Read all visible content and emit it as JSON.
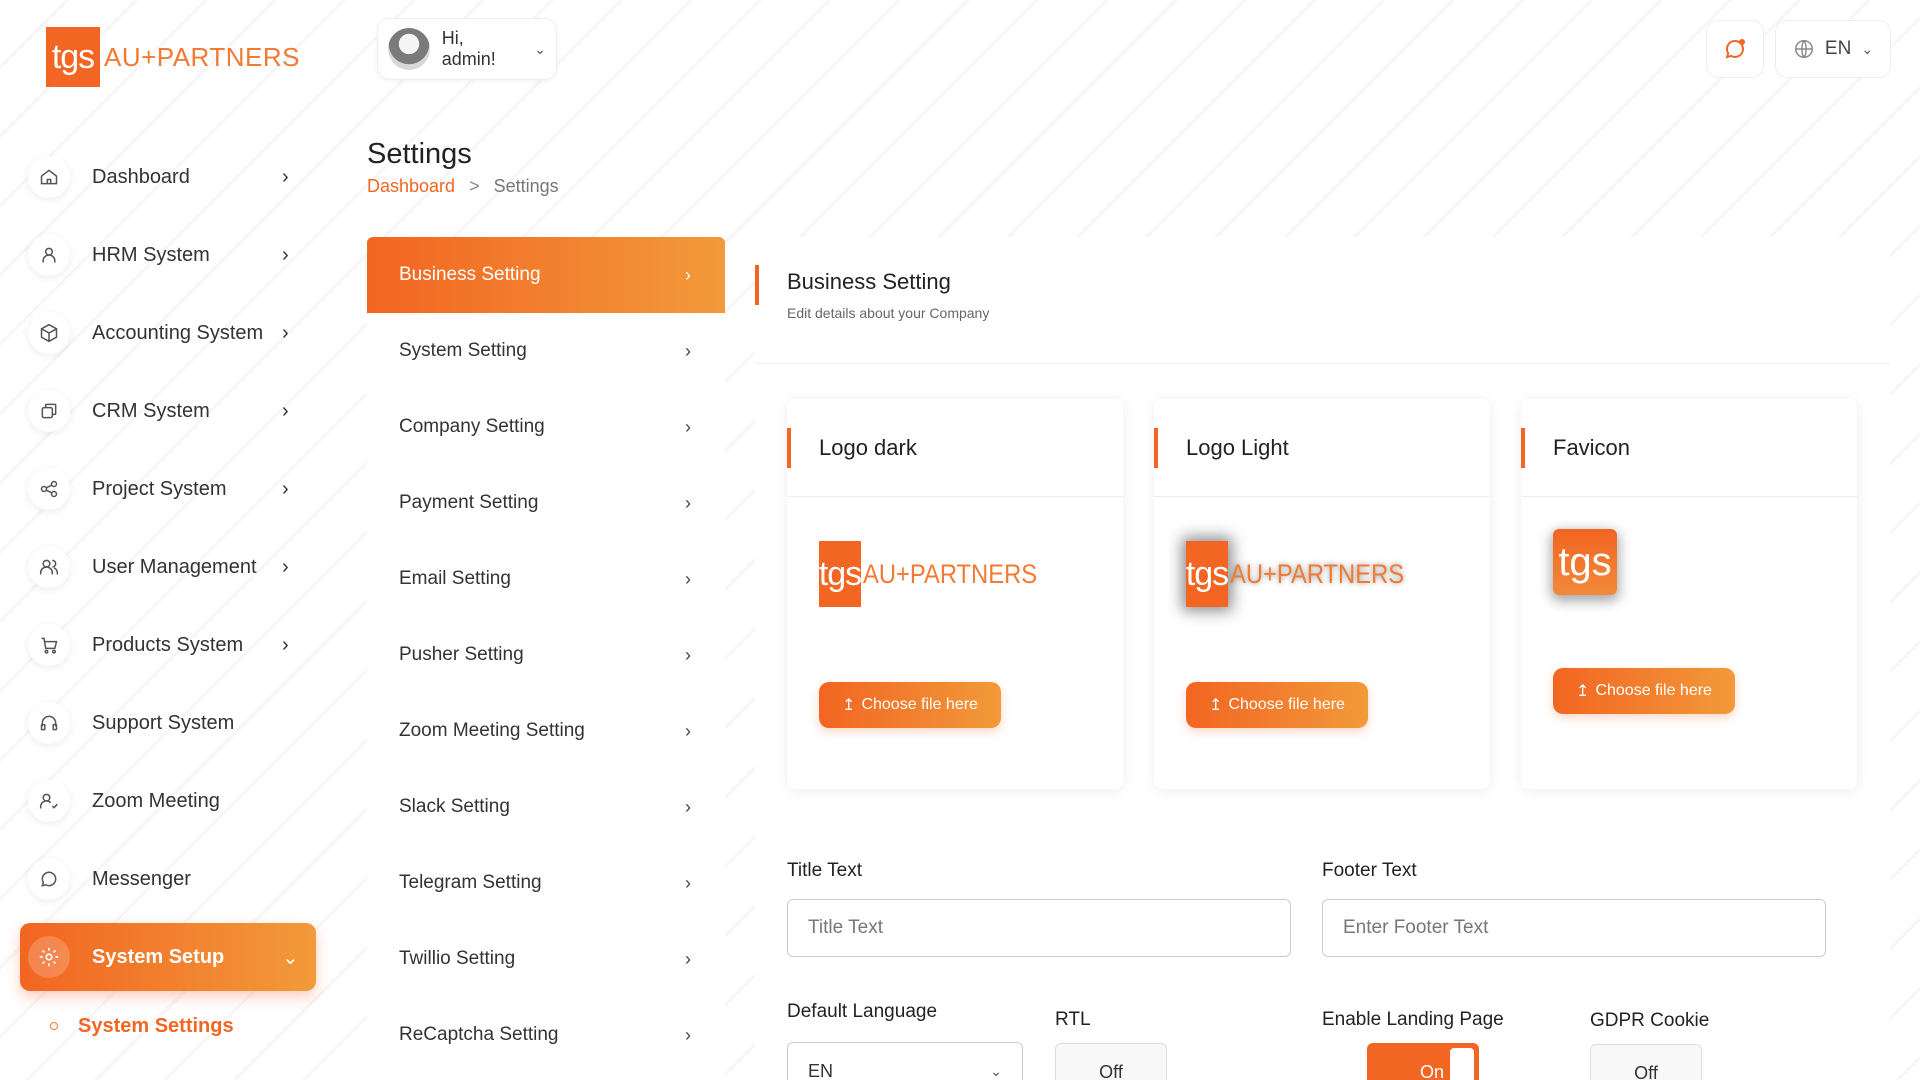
{
  "brand": {
    "box_text": "tgs",
    "word": "AU+PARTNERS"
  },
  "user": {
    "greeting": "Hi, admin!"
  },
  "language": {
    "current": "EN"
  },
  "sidebar": {
    "items": [
      {
        "label": "Dashboard",
        "icon": "home-icon"
      },
      {
        "label": "HRM System",
        "icon": "user-icon"
      },
      {
        "label": "Accounting System",
        "icon": "box-icon"
      },
      {
        "label": "CRM System",
        "icon": "layers-icon"
      },
      {
        "label": "Project System",
        "icon": "share-icon"
      },
      {
        "label": "User Management",
        "icon": "users-icon"
      },
      {
        "label": "Products System",
        "icon": "cart-icon"
      },
      {
        "label": "Support System",
        "icon": "headphones-icon"
      },
      {
        "label": "Zoom Meeting",
        "icon": "user-check-icon"
      },
      {
        "label": "Messenger",
        "icon": "message-icon"
      },
      {
        "label": "System Setup",
        "icon": "gear-icon"
      }
    ],
    "sub_items": [
      {
        "label": "System Settings"
      }
    ]
  },
  "page": {
    "title": "Settings",
    "breadcrumb": {
      "home": "Dashboard",
      "sep": ">",
      "current": "Settings"
    }
  },
  "settings_menu": {
    "items": [
      "Business Setting",
      "System Setting",
      "Company Setting",
      "Payment Setting",
      "Email Setting",
      "Pusher Setting",
      "Zoom Meeting Setting",
      "Slack Setting",
      "Telegram Setting",
      "Twillio Setting",
      "ReCaptcha Setting"
    ],
    "active_index": 0
  },
  "business": {
    "title": "Business Setting",
    "subtitle": "Edit details about your Company",
    "logo_cards": [
      {
        "title": "Logo dark",
        "button": "Choose file here"
      },
      {
        "title": "Logo Light",
        "button": "Choose file here"
      },
      {
        "title": "Favicon",
        "button": "Choose file here"
      }
    ],
    "title_text": {
      "label": "Title Text",
      "placeholder": "Title Text"
    },
    "footer_text": {
      "label": "Footer Text",
      "placeholder": "Enter Footer Text"
    },
    "default_language": {
      "label": "Default Language",
      "value": "EN"
    },
    "rtl": {
      "label": "RTL",
      "value": "Off"
    },
    "landing_page": {
      "label": "Enable Landing Page",
      "value": "On"
    },
    "gdpr": {
      "label": "GDPR Cookie",
      "value": "Off"
    }
  },
  "colors": {
    "accent": "#f26522",
    "accent_light": "#f29a3a"
  }
}
